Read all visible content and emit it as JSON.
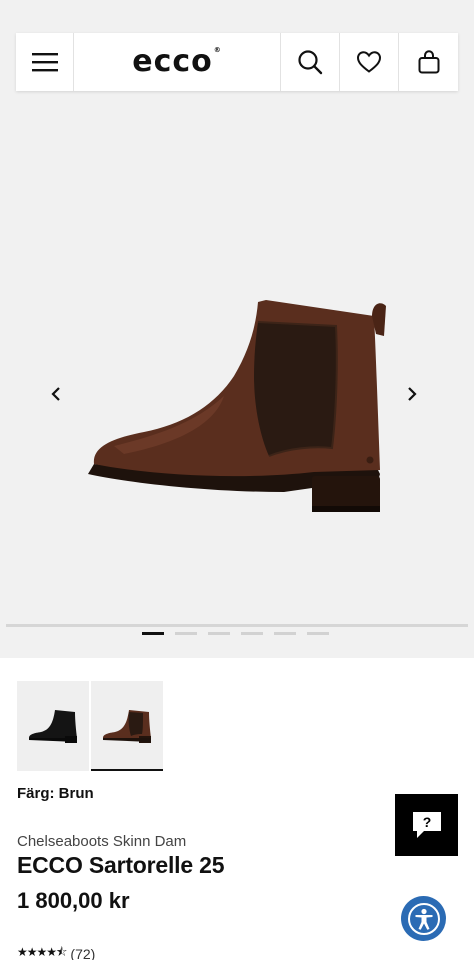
{
  "header": {
    "logo": "ecco",
    "logo_mark": "®",
    "icons": [
      "menu-icon",
      "search-icon",
      "heart-icon",
      "bag-icon"
    ]
  },
  "gallery": {
    "prev_icon": "chevron-left-icon",
    "next_icon": "chevron-right-icon",
    "slide_count": 6,
    "active_slide": 1
  },
  "thumbnails": [
    {
      "color": "black",
      "selected": false
    },
    {
      "color": "brown",
      "selected": true
    }
  ],
  "product": {
    "color_label": "Färg: Brun",
    "category": "Chelseaboots Skinn Dam",
    "title": "ECCO Sartorelle 25",
    "price": "1 800,00 kr",
    "rating_stars": "★★★★⯪",
    "rating_value": 4.5,
    "rating_count": "(72)"
  },
  "floating": {
    "chat_icon": "chat-question-icon",
    "chat_label": "?",
    "accessibility_icon": "accessibility-icon"
  },
  "colors": {
    "hero_bg": "#f1f1f1",
    "boot_brown": "#5a2e1e",
    "accessibility_blue": "#2b6bb4"
  }
}
